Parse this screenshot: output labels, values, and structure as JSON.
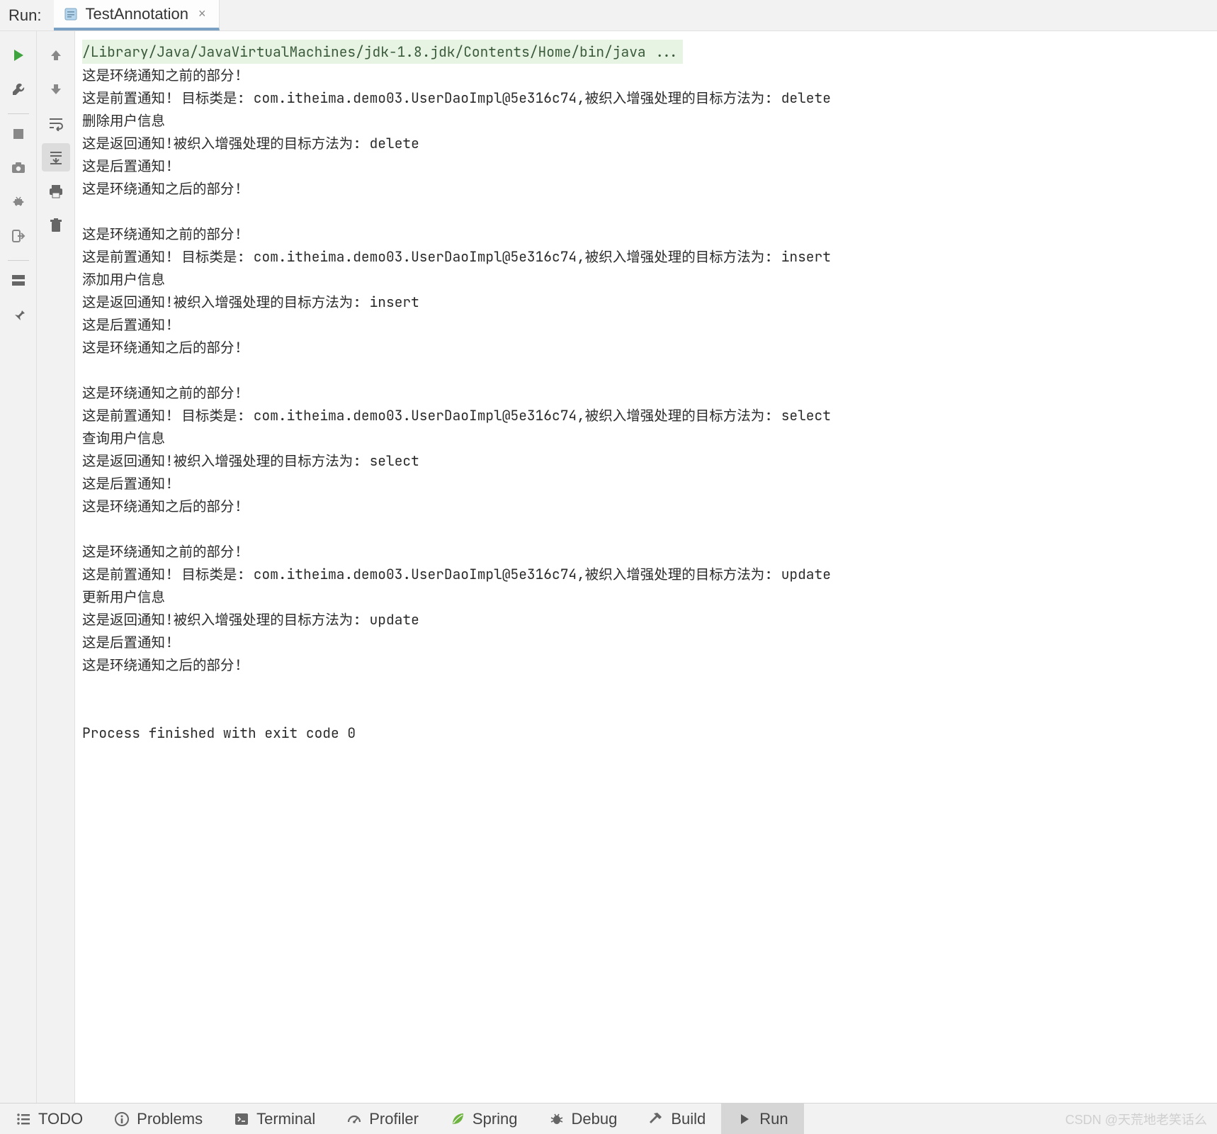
{
  "header": {
    "run_label": "Run:",
    "tab": {
      "label": "TestAnnotation",
      "close": "×"
    }
  },
  "left_toolbar": {
    "items": [
      {
        "name": "run-icon",
        "svg": "run",
        "color": "#3fa33f"
      },
      {
        "name": "wrench-icon",
        "svg": "wrench",
        "color": "#666"
      },
      {
        "sep": true
      },
      {
        "name": "stop-icon",
        "svg": "stop",
        "color": "#888"
      },
      {
        "name": "camera-icon",
        "svg": "camera",
        "color": "#888"
      },
      {
        "name": "bug-retry-icon",
        "svg": "bug",
        "color": "#888"
      },
      {
        "name": "exit-icon",
        "svg": "exit",
        "color": "#888"
      },
      {
        "sep": true
      },
      {
        "name": "layout-icon",
        "svg": "layout",
        "color": "#666"
      },
      {
        "name": "pin-icon",
        "svg": "pin",
        "color": "#666"
      }
    ]
  },
  "right_toolbar": {
    "items": [
      {
        "name": "up-icon",
        "svg": "up",
        "color": "#888"
      },
      {
        "name": "down-icon",
        "svg": "down",
        "color": "#888"
      },
      {
        "name": "soft-wrap-icon",
        "svg": "wrap",
        "color": "#666"
      },
      {
        "name": "scroll-end-icon",
        "svg": "scrollend",
        "color": "#666",
        "highlighted": true
      },
      {
        "name": "print-icon",
        "svg": "print",
        "color": "#666"
      },
      {
        "name": "trash-icon",
        "svg": "trash",
        "color": "#666"
      }
    ]
  },
  "console": {
    "command": "/Library/Java/JavaVirtualMachines/jdk-1.8.jdk/Contents/Home/bin/java ...",
    "lines": [
      "这是环绕通知之前的部分!",
      "这是前置通知! 目标类是: com.itheima.demo03.UserDaoImpl@5e316c74,被织入增强处理的目标方法为: delete",
      "删除用户信息",
      "这是返回通知!被织入增强处理的目标方法为: delete",
      "这是后置通知!",
      "这是环绕通知之后的部分!",
      "",
      "这是环绕通知之前的部分!",
      "这是前置通知! 目标类是: com.itheima.demo03.UserDaoImpl@5e316c74,被织入增强处理的目标方法为: insert",
      "添加用户信息",
      "这是返回通知!被织入增强处理的目标方法为: insert",
      "这是后置通知!",
      "这是环绕通知之后的部分!",
      "",
      "这是环绕通知之前的部分!",
      "这是前置通知! 目标类是: com.itheima.demo03.UserDaoImpl@5e316c74,被织入增强处理的目标方法为: select",
      "查询用户信息",
      "这是返回通知!被织入增强处理的目标方法为: select",
      "这是后置通知!",
      "这是环绕通知之后的部分!",
      "",
      "这是环绕通知之前的部分!",
      "这是前置通知! 目标类是: com.itheima.demo03.UserDaoImpl@5e316c74,被织入增强处理的目标方法为: update",
      "更新用户信息",
      "这是返回通知!被织入增强处理的目标方法为: update",
      "这是后置通知!",
      "这是环绕通知之后的部分!",
      ""
    ],
    "exit": "Process finished with exit code 0"
  },
  "bottom": {
    "items": [
      {
        "name": "todo-tab",
        "icon": "list",
        "label": "TODO"
      },
      {
        "name": "problems-tab",
        "icon": "info",
        "label": "Problems"
      },
      {
        "name": "terminal-tab",
        "icon": "terminal",
        "label": "Terminal"
      },
      {
        "name": "profiler-tab",
        "icon": "gauge",
        "label": "Profiler"
      },
      {
        "name": "spring-tab",
        "icon": "leaf",
        "label": "Spring"
      },
      {
        "name": "debug-tab",
        "icon": "bug2",
        "label": "Debug"
      },
      {
        "name": "build-tab",
        "icon": "hammer",
        "label": "Build"
      },
      {
        "name": "run-tab",
        "icon": "play",
        "label": "Run",
        "active": true
      }
    ]
  },
  "watermark": "CSDN @天荒地老笑话么"
}
